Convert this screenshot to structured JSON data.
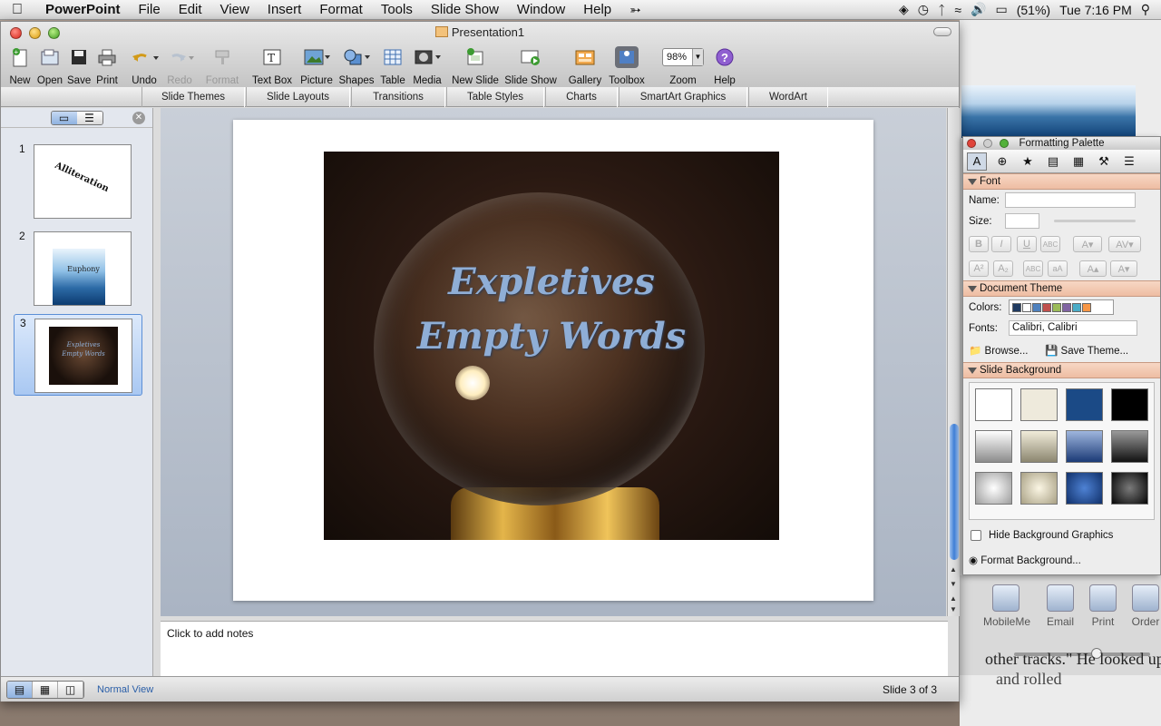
{
  "menubar": {
    "app": "PowerPoint",
    "items": [
      "File",
      "Edit",
      "View",
      "Insert",
      "Format",
      "Tools",
      "Slide Show",
      "Window",
      "Help"
    ],
    "battery": "(51%)",
    "clock": "Tue 7:16 PM"
  },
  "window": {
    "title": "Presentation1"
  },
  "toolbar": {
    "new": "New",
    "open": "Open",
    "save": "Save",
    "print": "Print",
    "undo": "Undo",
    "redo": "Redo",
    "format": "Format",
    "textbox": "Text Box",
    "picture": "Picture",
    "shapes": "Shapes",
    "table": "Table",
    "media": "Media",
    "newslide": "New Slide",
    "slideshow": "Slide Show",
    "gallery": "Gallery",
    "toolbox": "Toolbox",
    "zoom_value": "98%",
    "zoom": "Zoom",
    "help": "Help"
  },
  "ribbon_tabs": [
    "Slide Themes",
    "Slide Layouts",
    "Transitions",
    "Table Styles",
    "Charts",
    "SmartArt Graphics",
    "WordArt"
  ],
  "slides": [
    {
      "num": "1",
      "text": "Alliteration"
    },
    {
      "num": "2",
      "text": "Euphony"
    },
    {
      "num": "3",
      "line1": "Expletives",
      "line2": "Empty Words"
    }
  ],
  "current_slide": {
    "line1": "Expletives",
    "line2": "Empty Words"
  },
  "notes_placeholder": "Click to add notes",
  "status": {
    "view": "Normal View",
    "slide_count": "Slide 3 of 3"
  },
  "palette": {
    "title": "Formatting Palette",
    "font_section": "Font",
    "name_label": "Name:",
    "size_label": "Size:",
    "theme_section": "Document Theme",
    "colors_label": "Colors:",
    "theme_colors": [
      "#1f3a60",
      "#ffffff",
      "#4f81bd",
      "#c0504d",
      "#9bbb59",
      "#8064a2",
      "#4bacc6",
      "#f79646"
    ],
    "fonts_label": "Fonts:",
    "fonts_value": "Calibri, Calibri",
    "browse": "Browse...",
    "save_theme": "Save Theme...",
    "background_section": "Slide Background",
    "hide_bg": "Hide Background Graphics",
    "format_bg": "Format Background..."
  },
  "background_window": {
    "buttons": [
      "MobileMe",
      "Email",
      "Print",
      "Order"
    ],
    "text1": "other tracks.\" He looked up",
    "text2": "and rolled"
  }
}
